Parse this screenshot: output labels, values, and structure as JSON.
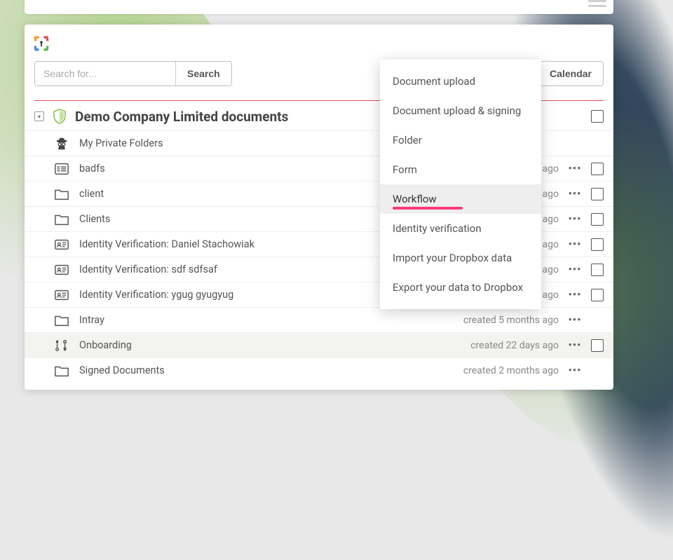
{
  "search": {
    "placeholder": "Search for...",
    "button_label": "Search"
  },
  "toolbar": {
    "calendar_label": "Calendar"
  },
  "page": {
    "title": "Demo Company Limited documents"
  },
  "dropdown": {
    "items": [
      {
        "label": "Document upload",
        "highlighted": false
      },
      {
        "label": "Document upload & signing",
        "highlighted": false
      },
      {
        "label": "Folder",
        "highlighted": false
      },
      {
        "label": "Form",
        "highlighted": false
      },
      {
        "label": "Workflow",
        "highlighted": true
      },
      {
        "label": "Identity verification",
        "highlighted": false
      },
      {
        "label": "Import your Dropbox data",
        "highlighted": false
      },
      {
        "label": "Export your data to Dropbox",
        "highlighted": false
      }
    ]
  },
  "rows": [
    {
      "icon": "spy",
      "label": "My Private Folders",
      "meta": "",
      "selectable": false
    },
    {
      "icon": "form",
      "label": "badfs",
      "meta": "ago",
      "selectable": true
    },
    {
      "icon": "folder",
      "label": "client",
      "meta": "ago",
      "selectable": true
    },
    {
      "icon": "folder",
      "label": "Clients",
      "meta": "ago",
      "selectable": true
    },
    {
      "icon": "idcard",
      "label": "Identity Verification: Daniel Stachowiak",
      "meta": "ago",
      "selectable": true
    },
    {
      "icon": "idcard",
      "label": "Identity Verification: sdf sdfsaf",
      "meta": "ago",
      "selectable": true
    },
    {
      "icon": "idcard",
      "label": "Identity Verification: ygug gyugyug",
      "meta": "ago",
      "selectable": true
    },
    {
      "icon": "folder",
      "label": "Intray",
      "meta": "created 5 months ago",
      "selectable": false
    },
    {
      "icon": "workflow",
      "label": "Onboarding",
      "meta": "created 22 days ago",
      "selectable": true,
      "selected": true
    },
    {
      "icon": "folder",
      "label": "Signed Documents",
      "meta": "created 2 months ago",
      "selectable": false
    }
  ]
}
